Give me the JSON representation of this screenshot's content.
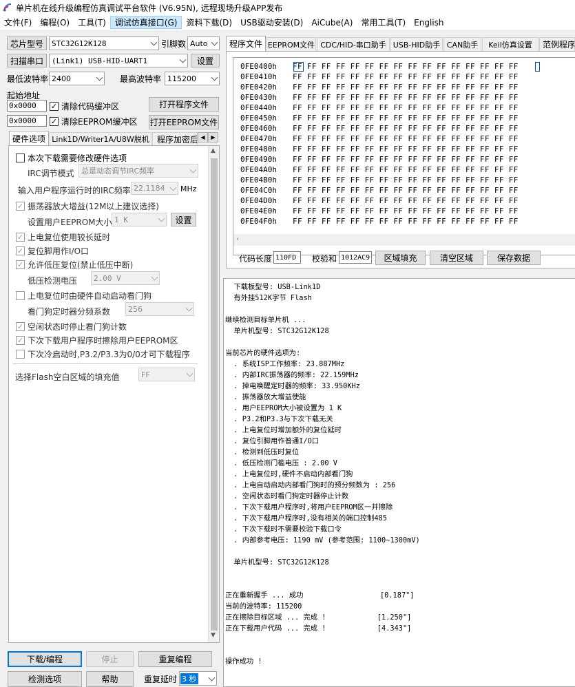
{
  "title": "单片机在线升级编程仿真调试平台软件 (V6.95N), 远程现场升级APP发布",
  "menu": [
    "文件(F)",
    "编程(O)",
    "工具(T)",
    "调试仿真接口(G)",
    "资料下载(D)",
    "USB驱动安装(D)",
    "AiCube(A)",
    "常用工具(T)",
    "English"
  ],
  "left": {
    "chip_btn": "芯片型号",
    "chip_value": "STC32G12K128",
    "pins_label": "引脚数",
    "pins_value": "Auto",
    "scan_btn": "扫描串口",
    "port_value": "(Link1) USB-HID-UART1",
    "settings_btn": "设置",
    "min_baud_label": "最低波特率",
    "min_baud_value": "2400",
    "max_baud_label": "最高波特率",
    "max_baud_value": "115200",
    "start_addr_label": "起始地址",
    "addr1": "0x0000",
    "clear_code": "清除代码缓冲区",
    "open_prog": "打开程序文件",
    "addr2": "0x0000",
    "clear_eeprom": "清除EEPROM缓冲区",
    "open_eeprom": "打开EEPROM文件",
    "tabs": [
      "硬件选项",
      "Link1D/Writer1A/U8W脱机",
      "程序加密后"
    ],
    "hw": {
      "modify_hw": "本次下载需要修改硬件选项",
      "irc_mode_label": "IRC调节模式",
      "irc_mode_value": "总是动态调节IRC频率",
      "irc_freq_label": "输入用户程序运行时的IRC频率",
      "irc_freq_value": "22.1184",
      "irc_freq_unit": "MHz",
      "osc_gain": "振荡器放大增益(12M以上建议选择)",
      "eeprom_size_label": "设置用户EEPROM大小",
      "eeprom_size_value": "1   K",
      "eeprom_set_btn": "设置",
      "por_delay": "上电复位使用较长延时",
      "reset_pin": "复位脚用作I/O口",
      "lvr": "允许低压复位(禁止低压中断)",
      "lvd_label": "低压检测电压",
      "lvd_value": "2.00 V",
      "wdt_hw": "上电复位时由硬件自动启动看门狗",
      "wdt_div_label": "看门狗定时器分频系数",
      "wdt_div_value": "256",
      "idle_wdt": "空闲状态时停止看门狗计数",
      "erase_eeprom": "下次下载用户程序时擦除用户EEPROM区",
      "p32p33": "下次冷启动时,P3.2/P3.3为0/0才可下载程序",
      "fill_label": "选择Flash空白区域的填充值",
      "fill_value": "FF"
    },
    "download_btn": "下载/编程",
    "stop_btn": "停止",
    "reprog_btn": "重复编程",
    "check_btn": "检测选项",
    "help_btn": "帮助",
    "repeat_delay_label": "重复延时",
    "repeat_delay_value": "3 秒"
  },
  "right": {
    "tabs": [
      "程序文件",
      "EEPROM文件",
      "CDC/HID-串口助手",
      "USB-HID助手",
      "CAN助手",
      "Keil仿真设置",
      "范例程序"
    ],
    "hex_rows": [
      {
        "addr": "0FE0400h",
        "data": "FF FF FF FF FF FF FF FF FF FF FF FF FF FF FF FF"
      },
      {
        "addr": "0FE0410h",
        "data": "FF FF FF FF FF FF FF FF FF FF FF FF FF FF FF FF"
      },
      {
        "addr": "0FE0420h",
        "data": "FF FF FF FF FF FF FF FF FF FF FF FF FF FF FF FF"
      },
      {
        "addr": "0FE0430h",
        "data": "FF FF FF FF FF FF FF FF FF FF FF FF FF FF FF FF"
      },
      {
        "addr": "0FE0440h",
        "data": "FF FF FF FF FF FF FF FF FF FF FF FF FF FF FF FF"
      },
      {
        "addr": "0FE0450h",
        "data": "FF FF FF FF FF FF FF FF FF FF FF FF FF FF FF FF"
      },
      {
        "addr": "0FE0460h",
        "data": "FF FF FF FF FF FF FF FF FF FF FF FF FF FF FF FF"
      },
      {
        "addr": "0FE0470h",
        "data": "FF FF FF FF FF FF FF FF FF FF FF FF FF FF FF FF"
      },
      {
        "addr": "0FE0480h",
        "data": "FF FF FF FF FF FF FF FF FF FF FF FF FF FF FF FF"
      },
      {
        "addr": "0FE0490h",
        "data": "FF FF FF FF FF FF FF FF FF FF FF FF FF FF FF FF"
      },
      {
        "addr": "0FE04A0h",
        "data": "FF FF FF FF FF FF FF FF FF FF FF FF FF FF FF FF"
      },
      {
        "addr": "0FE04B0h",
        "data": "FF FF FF FF FF FF FF FF FF FF FF FF FF FF FF FF"
      },
      {
        "addr": "0FE04C0h",
        "data": "FF FF FF FF FF FF FF FF FF FF FF FF FF FF FF FF"
      },
      {
        "addr": "0FE04D0h",
        "data": "FF FF FF FF FF FF FF FF FF FF FF FF FF FF FF FF"
      },
      {
        "addr": "0FE04E0h",
        "data": "FF FF FF FF FF FF FF FF FF FF FF FF FF FF FF FF"
      },
      {
        "addr": "0FE04F0h",
        "data": "FF FF FF FF FF FF FF FF FF FF FF FF FF FF FF FF"
      }
    ],
    "code_len_label": "代码长度",
    "code_len_value": "110FD",
    "checksum_label": "校验和",
    "checksum_value": "1012AC9",
    "fill_area_btn": "区域填充",
    "clear_area_btn": "清空区域",
    "save_btn": "保存数据",
    "log_lines": [
      "  下载板型号: USB-Link1D",
      "  有外挂512K字节 Flash",
      "",
      "继续检测目标单片机 ...",
      "  单片机型号: STC32G12K128",
      "",
      "当前芯片的硬件选项为:",
      "  . 系统ISP工作频率: 23.887MHz",
      "  . 内部IRC振荡器的频率: 22.159MHz",
      "  . 掉电唤醒定时器的频率: 33.950KHz",
      "  . 振荡器放大增益使能",
      "  . 用户EEPROM大小被设置为 1 K",
      "  . P3.2和P3.3与下次下载无关",
      "  . 上电复位时增加额外的复位延时",
      "  . 复位引脚用作普通I/O口",
      "  . 检测到低压时复位",
      "  . 低压检测门槛电压 : 2.00 V",
      "  . 上电复位时,硬件不启动内部看门狗",
      "  . 上电自动启动内部看门狗时的预分频数为 : 256",
      "  . 空闲状态时看门狗定时器停止计数",
      "  . 下次下载用户程序时,将用户EEPROM区一并擦除",
      "  . 下次下载用户程序时,没有相关的端口控制485",
      "  . 下次下载时不需要校验下载口令",
      "  . 内部参考电压: 1190 mV (参考范围: 1100~1300mV)",
      "",
      "  单片机型号: STC32G12K128",
      "",
      "",
      "正在重新握手 ... 成功                  [0.187\"]",
      "当前的波特率: 115200",
      "正在擦除目标区域 ... 完成 !            [1.250\"]",
      "正在下载用户代码 ... 完成 !            [4.343\"]",
      "",
      "",
      "操作成功 !"
    ]
  }
}
